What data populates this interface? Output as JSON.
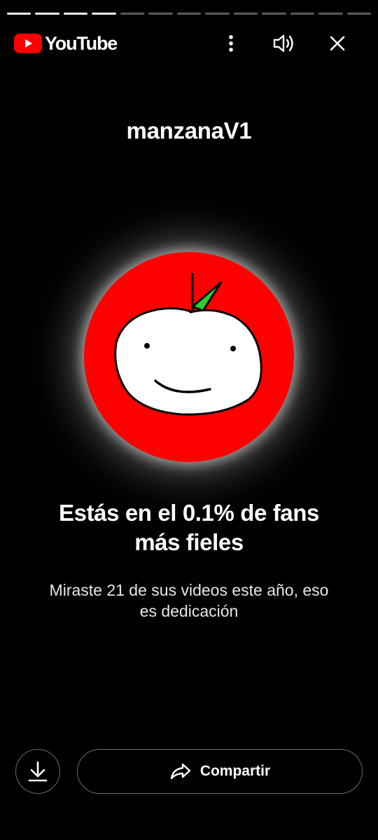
{
  "progress": {
    "segments_total": 13,
    "segments_done": 4
  },
  "header": {
    "logo_text": "YouTube",
    "more_icon": "more-vert-icon",
    "sound_icon": "volume-icon",
    "close_icon": "close-icon"
  },
  "channel": {
    "name": "manzanaV1",
    "avatar_color": "#ff0000"
  },
  "headline": {
    "line1": "Estás en el 0.1% de fans",
    "line2": "más fieles"
  },
  "subtext": {
    "line1": "Miraste 21 de sus videos este año, eso",
    "line2": "es dedicación"
  },
  "actions": {
    "download_icon": "download-icon",
    "share_icon": "share-arrow-icon",
    "share_label": "Compartir"
  },
  "colors": {
    "background": "#000000",
    "brand_red": "#ff0000",
    "leaf_green": "#2ecc2e"
  }
}
